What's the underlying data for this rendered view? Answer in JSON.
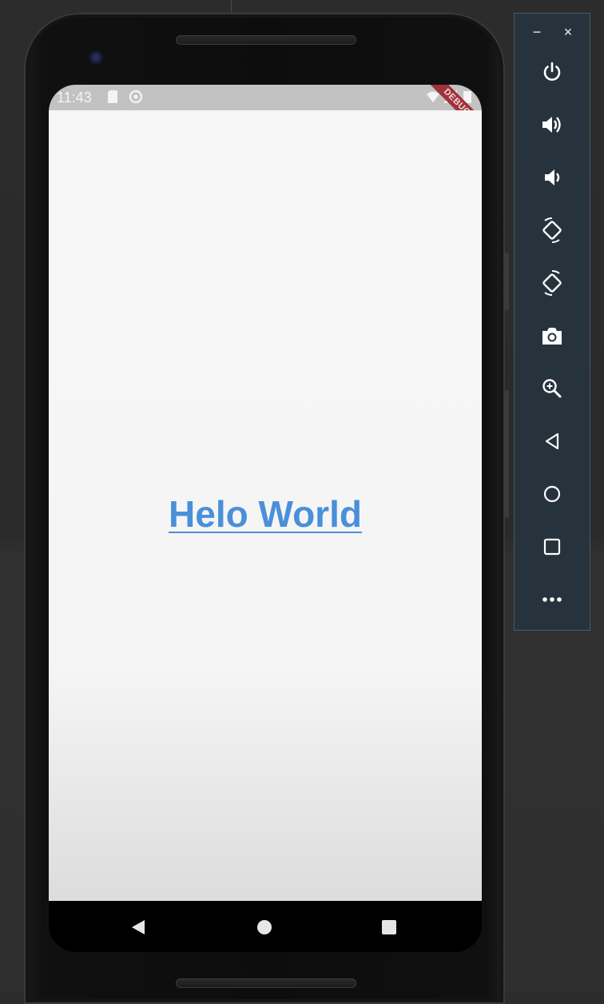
{
  "status_bar": {
    "time": "11:43",
    "debug_label": "DEBUG"
  },
  "app": {
    "text": "Helo World",
    "text_color": "#4a90d9"
  },
  "nav_bar": {
    "back_icon": "back-triangle-icon",
    "home_icon": "home-circle-icon",
    "recents_icon": "recents-square-icon"
  },
  "emulator_panel": {
    "minimize_label": "−",
    "close_label": "×",
    "tools": [
      {
        "name": "power-icon"
      },
      {
        "name": "volume-up-icon"
      },
      {
        "name": "volume-down-icon"
      },
      {
        "name": "rotate-left-icon"
      },
      {
        "name": "rotate-right-icon"
      },
      {
        "name": "camera-icon"
      },
      {
        "name": "zoom-icon"
      },
      {
        "name": "back-icon"
      },
      {
        "name": "home-icon"
      },
      {
        "name": "overview-icon"
      },
      {
        "name": "more-icon"
      }
    ]
  }
}
